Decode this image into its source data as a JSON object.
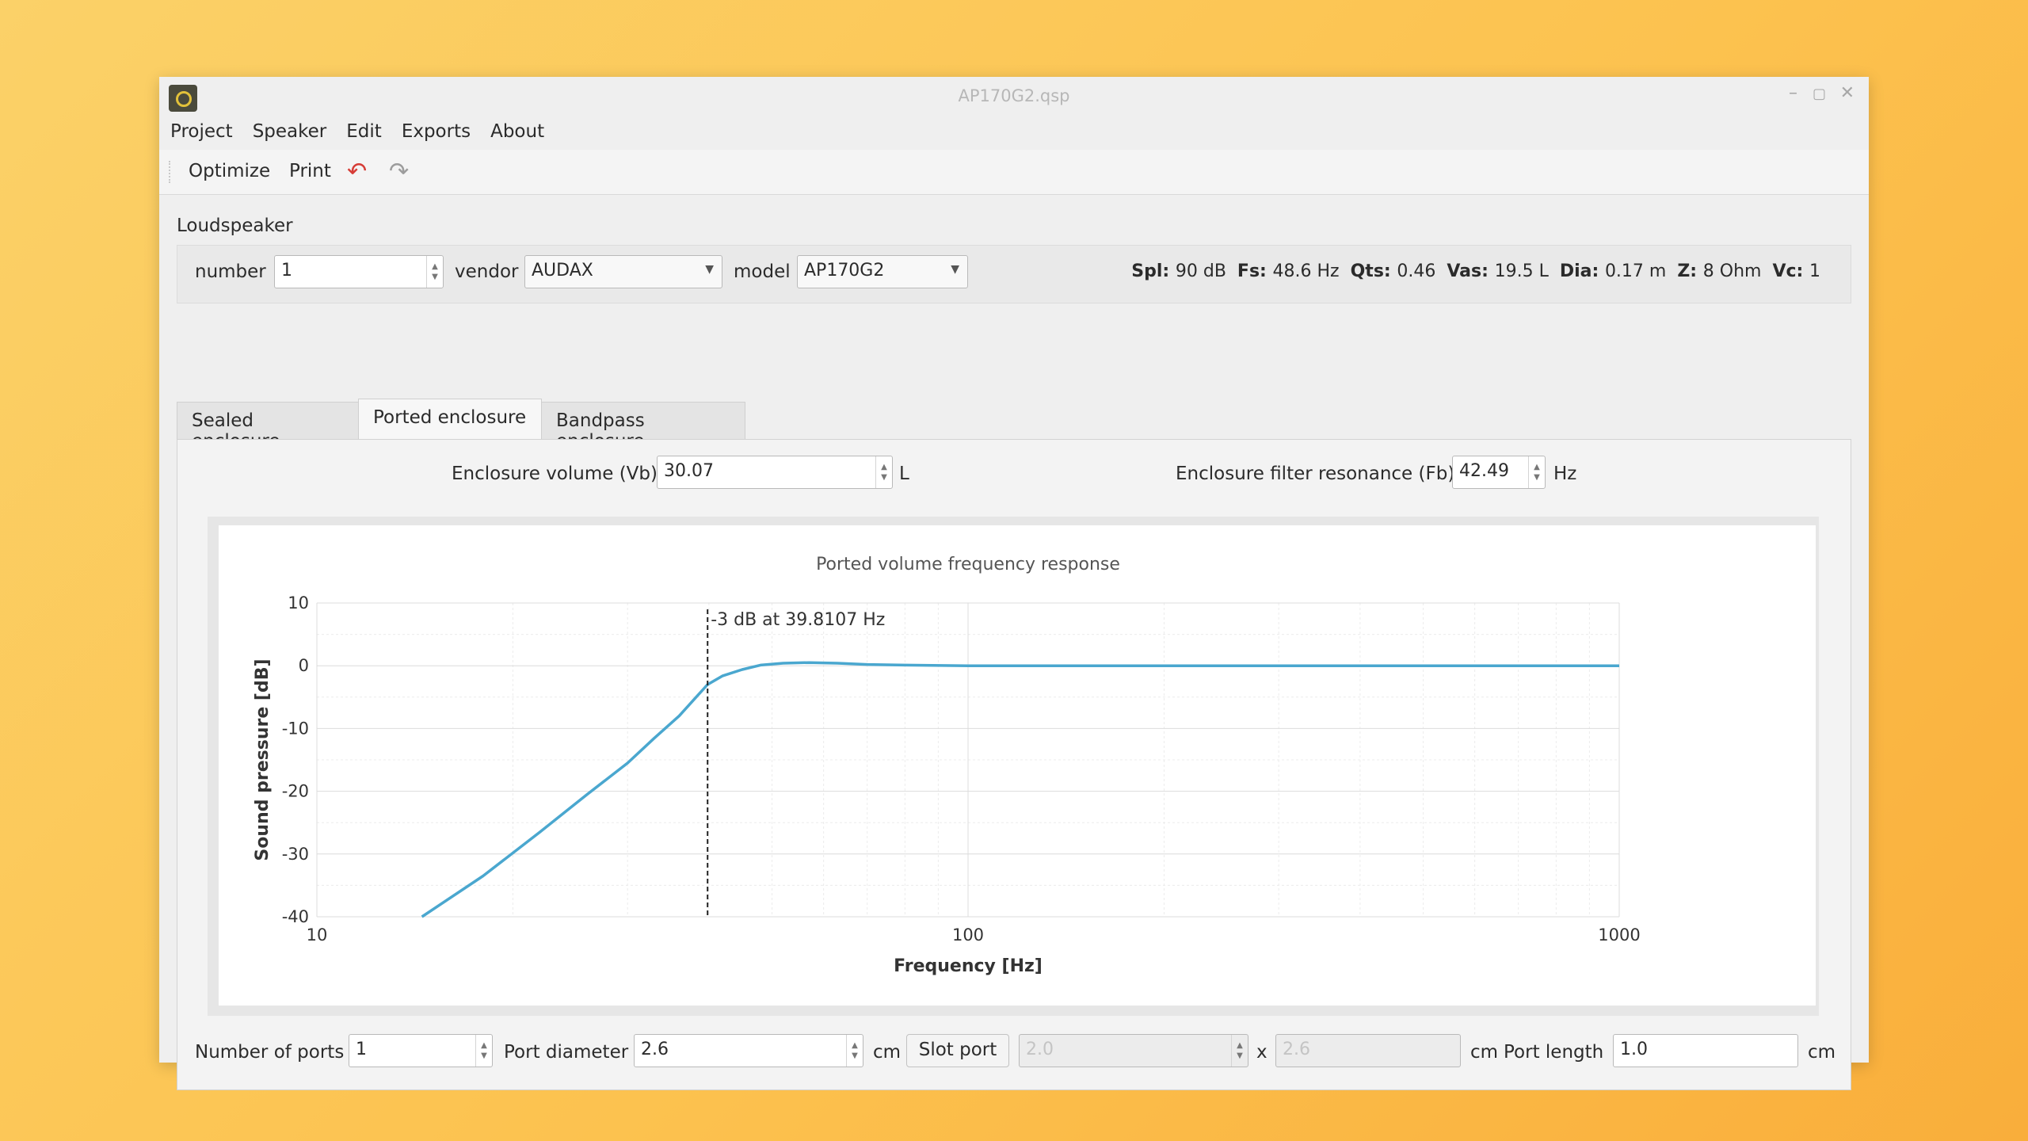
{
  "window": {
    "title": "AP170G2.qsp"
  },
  "menu": [
    "Project",
    "Speaker",
    "Edit",
    "Exports",
    "About"
  ],
  "toolbar": {
    "optimize": "Optimize",
    "print": "Print"
  },
  "loudspeaker": {
    "section": "Loudspeaker",
    "number_label": "number",
    "number_value": "1",
    "vendor_label": "vendor",
    "vendor_value": "AUDAX",
    "model_label": "model",
    "model_value": "AP170G2",
    "params": [
      {
        "name": "Spl:",
        "value": "90",
        "unit": "dB"
      },
      {
        "name": "Fs:",
        "value": "48.6",
        "unit": "Hz"
      },
      {
        "name": "Qts:",
        "value": "0.46",
        "unit": ""
      },
      {
        "name": "Vas:",
        "value": "19.5",
        "unit": "L"
      },
      {
        "name": "Dia:",
        "value": "0.17",
        "unit": "m"
      },
      {
        "name": "Z:",
        "value": "8",
        "unit": "Ohm"
      },
      {
        "name": "Vc:",
        "value": "1",
        "unit": ""
      }
    ]
  },
  "tabs": [
    "Sealed enclosure",
    "Ported enclosure",
    "Bandpass enclosure"
  ],
  "active_tab": 1,
  "enclosure": {
    "vb_label": "Enclosure volume (Vb)",
    "vb_value": "30.07",
    "vb_unit": "L",
    "fb_label": "Enclosure filter resonance (Fb)",
    "fb_value": "42.49",
    "fb_unit": "Hz"
  },
  "ports": {
    "number_label": "Number of ports",
    "number_value": "1",
    "diameter_label": "Port diameter",
    "diameter_value": "2.6",
    "diameter_unit": "cm",
    "slot_button": "Slot port",
    "slot_w": "2.0",
    "slot_x": "x",
    "slot_h": "2.6",
    "slot_unit": "cm",
    "length_label": "Port length",
    "length_value": "1.0",
    "length_unit": "cm"
  },
  "chart_data": {
    "type": "line",
    "title": "Ported volume frequency response",
    "xlabel": "Frequency [Hz]",
    "ylabel": "Sound pressure [dB]",
    "xscale": "log",
    "xlim": [
      10,
      1000
    ],
    "ylim": [
      -40,
      10
    ],
    "xticks": [
      10,
      100,
      1000
    ],
    "yticks": [
      10,
      0,
      -10,
      -20,
      -30,
      -40
    ],
    "grid": true,
    "line_color": "#4aa7cf",
    "series": [
      {
        "x": [
          14.5,
          18,
          22,
          26,
          30,
          33,
          36,
          38,
          39.8,
          42,
          45,
          48,
          52,
          57,
          63,
          70,
          80,
          100,
          150,
          200,
          300,
          500,
          1000
        ],
        "y": [
          -40,
          -33.5,
          -26.5,
          -20.5,
          -15.5,
          -11.5,
          -8,
          -5.3,
          -3,
          -1.6,
          -0.6,
          0.1,
          0.4,
          0.5,
          0.4,
          0.2,
          0.1,
          0,
          0,
          0,
          0,
          0,
          0
        ]
      }
    ],
    "marker": {
      "x": 39.8107,
      "label": "-3 dB at 39.8107 Hz"
    }
  }
}
